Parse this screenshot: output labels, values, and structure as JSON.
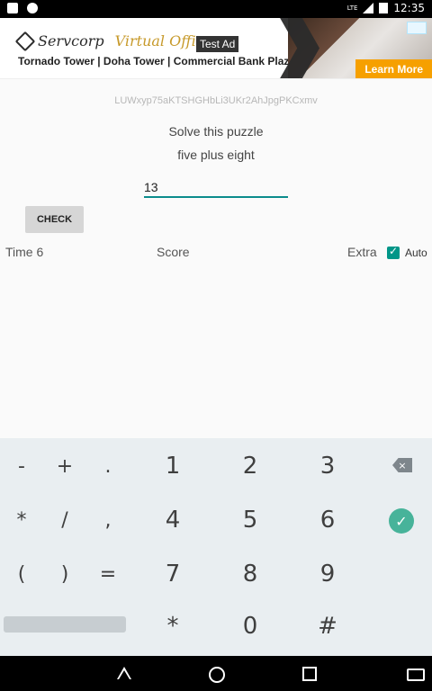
{
  "status": {
    "time": "12:35",
    "network": "LTE"
  },
  "ad": {
    "label": "Test Ad",
    "brand": "Servcorp",
    "brand_highlight": "Virtual Office",
    "subtitle": "Tornado Tower | Doha Tower | Commercial Bank Plaza",
    "cta": "Learn More"
  },
  "app": {
    "code": "LUWxyp75aKTSHGHbLi3UKr2AhJpgPKCxmv",
    "puzzle_title": "Solve this puzzle",
    "puzzle_expression": "five plus eight",
    "answer_value": "13",
    "check_label": "CHECK",
    "time_label": "Time 6",
    "score_label": "Score",
    "extra_label": "Extra",
    "auto_label": "Auto",
    "auto_checked": true
  },
  "keyboard": {
    "row1": [
      "-",
      "+",
      ".",
      "1",
      "2",
      "3"
    ],
    "row2": [
      "*",
      "/",
      ",",
      "4",
      "5",
      "6"
    ],
    "row3": [
      "(",
      ")",
      "=",
      "7",
      "8",
      "9"
    ],
    "row4": [
      "*",
      "0",
      "#"
    ]
  },
  "nav": {
    "back": "back-icon",
    "home": "home-icon",
    "recent": "recent-apps-icon",
    "keyboard": "keyboard-icon"
  }
}
